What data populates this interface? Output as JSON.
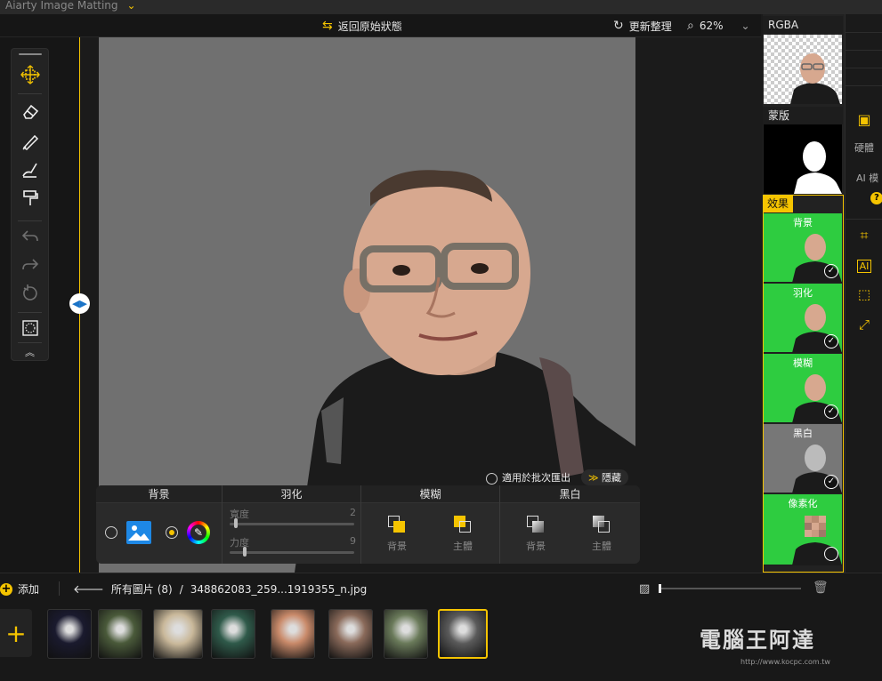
{
  "app": {
    "title": "Aiarty Image Matting"
  },
  "toolbar": {
    "revert_label": "返回原始狀態",
    "refresh_label": "更新整理",
    "zoom_level": "62%"
  },
  "tools": [
    "move-tool",
    "eraser-tool",
    "brush-tool",
    "fill-tool",
    "roller-tool",
    "undo-tool",
    "redo-tool",
    "reset-tool",
    "mask-view-tool",
    "collapse-tool"
  ],
  "right_panel": {
    "rgba_label": "RGBA",
    "mask_label": "蒙版",
    "effects_label": "效果",
    "effects": [
      {
        "label": "背景",
        "applied": true,
        "color": "#2ecc40"
      },
      {
        "label": "羽化",
        "applied": true,
        "color": "#2ecc40"
      },
      {
        "label": "模糊",
        "applied": true,
        "color": "#2ecc40"
      },
      {
        "label": "黑白",
        "applied": true,
        "color": "#777777"
      },
      {
        "label": "像素化",
        "applied": false,
        "color": "#2ecc40"
      }
    ]
  },
  "side_strip": {
    "hardness_label": "硬體",
    "ai_model_label": "AI 模",
    "help": "?"
  },
  "batch": {
    "apply_batch_label": "適用於批次匯出",
    "hide_label": "隱藏"
  },
  "effect_panel": {
    "background": {
      "title": "背景"
    },
    "feather": {
      "title": "羽化",
      "width_label": "寬度",
      "width_value": "2",
      "strength_label": "力度",
      "strength_value": "9"
    },
    "blur": {
      "title": "模糊",
      "bg_label": "背景",
      "subject_label": "主體"
    },
    "bw": {
      "title": "黑白",
      "bg_label": "背景",
      "subject_label": "主體"
    }
  },
  "bottom": {
    "add_label": "添加",
    "all_images_label": "所有圖片 (8)",
    "separator": "/",
    "filename": "348862083_259...1919355_n.jpg"
  },
  "film_thumbs": [
    {
      "name": "jellyfish",
      "color": "#1a1a2e"
    },
    {
      "name": "forest-rocks",
      "color": "#4a5a3a"
    },
    {
      "name": "bicycle",
      "color": "#c9b89a"
    },
    {
      "name": "woman-red-dress-forest",
      "color": "#2f5a4a"
    },
    {
      "name": "woman-flowers",
      "color": "#c98a6a"
    },
    {
      "name": "woman-lace",
      "color": "#8a6a5a"
    },
    {
      "name": "woman-white-dress",
      "color": "#6a7a5a"
    },
    {
      "name": "selfie-man",
      "color": "#5a5a5a"
    }
  ],
  "watermark": {
    "text": "電腦王阿達",
    "url": "http://www.kocpc.com.tw"
  },
  "colors": {
    "accent": "#f5c400",
    "green_bg": "#2ecc40",
    "canvas_gray": "#707070"
  }
}
